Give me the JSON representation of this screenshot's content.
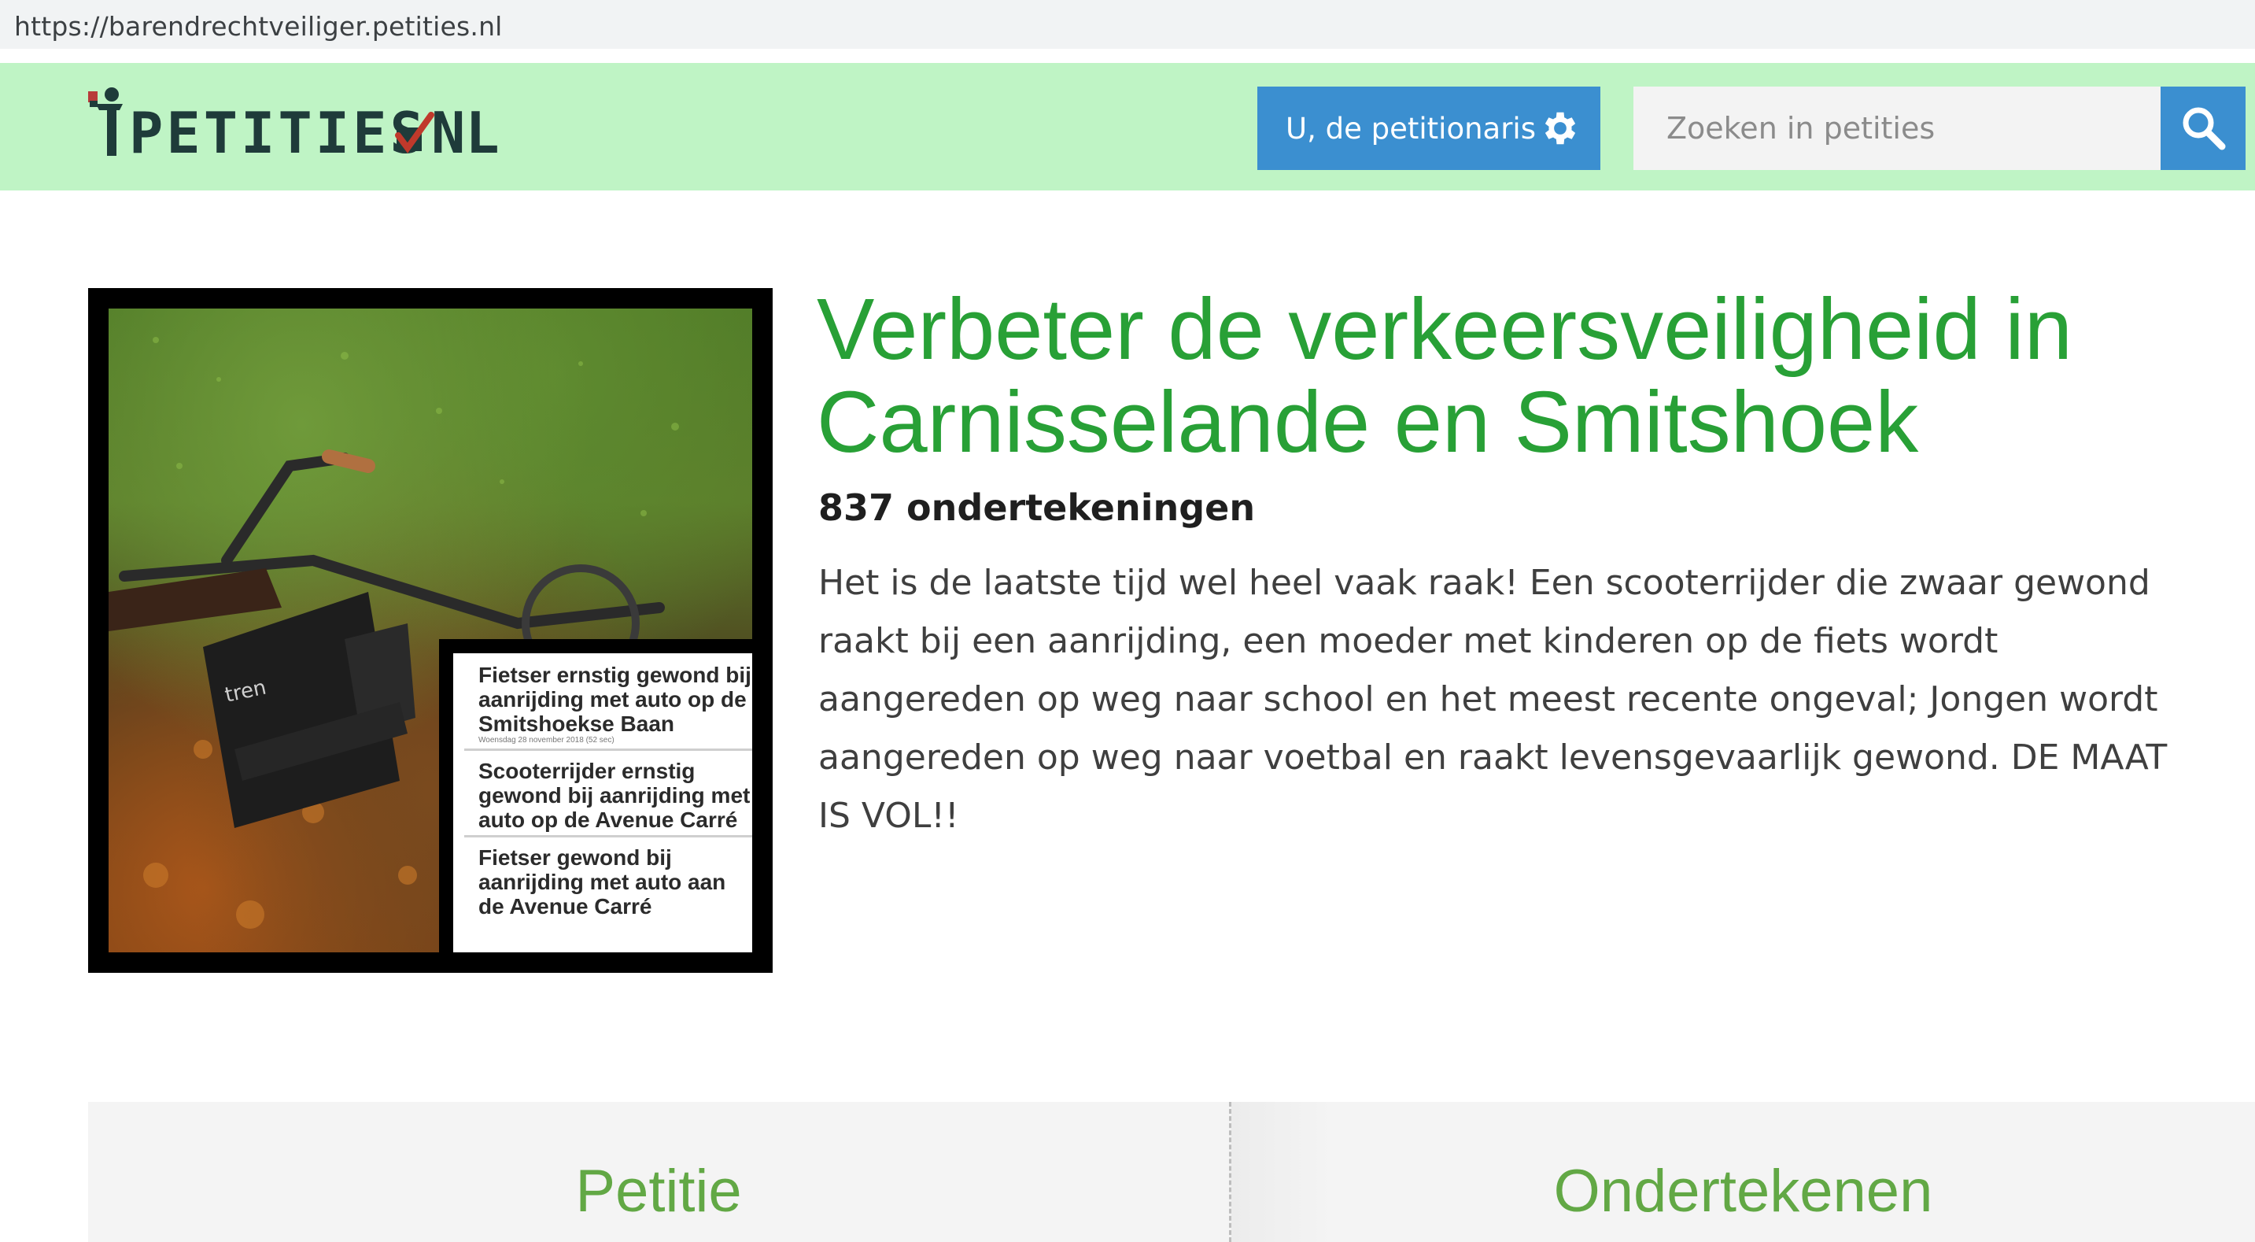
{
  "browser": {
    "url": "https://barendrechtveiliger.petities.nl"
  },
  "header": {
    "logo_text": "PETITIES.NL",
    "petitionaris_label": "U, de petitionaris",
    "search_placeholder": "Zoeken in petities",
    "icons": [
      "gear-icon",
      "search-icon"
    ],
    "colors": {
      "header_bg": "#bff4c5",
      "button_blue": "#3b8fd0"
    }
  },
  "petition": {
    "title": "Verbeter de verkeersveiligheid in Carnisselande en Smitshoek",
    "signatures": "837 ondertekeningen",
    "description": "Het is de laatste tijd wel heel vaak raak! Een scooterrijder die zwaar gewond raakt bij een aanrijding, een moeder met kinderen op de fiets wordt aangereden op weg naar school en het meest recente ongeval; Jongen wordt aangereden op weg naar voetbal en raakt levensgevaarlijk gewond. DE MAAT IS VOL!!",
    "title_color": "#28a036",
    "image_headlines": [
      "Fietser ernstig gewond bij aanrijding met auto op de Smitshoekse Baan",
      "Scooterrijder ernstig gewond bij aanrijding met auto op de Avenue Carré",
      "Fietser gewond bij aanrijding met auto aan de Avenue Carré"
    ],
    "image_meta": "Woensdag 28 november 2018 (52 sec)"
  },
  "tabs": {
    "petitie": "Petitie",
    "ondertekenen": "Ondertekenen",
    "tab_color": "#62a845"
  }
}
